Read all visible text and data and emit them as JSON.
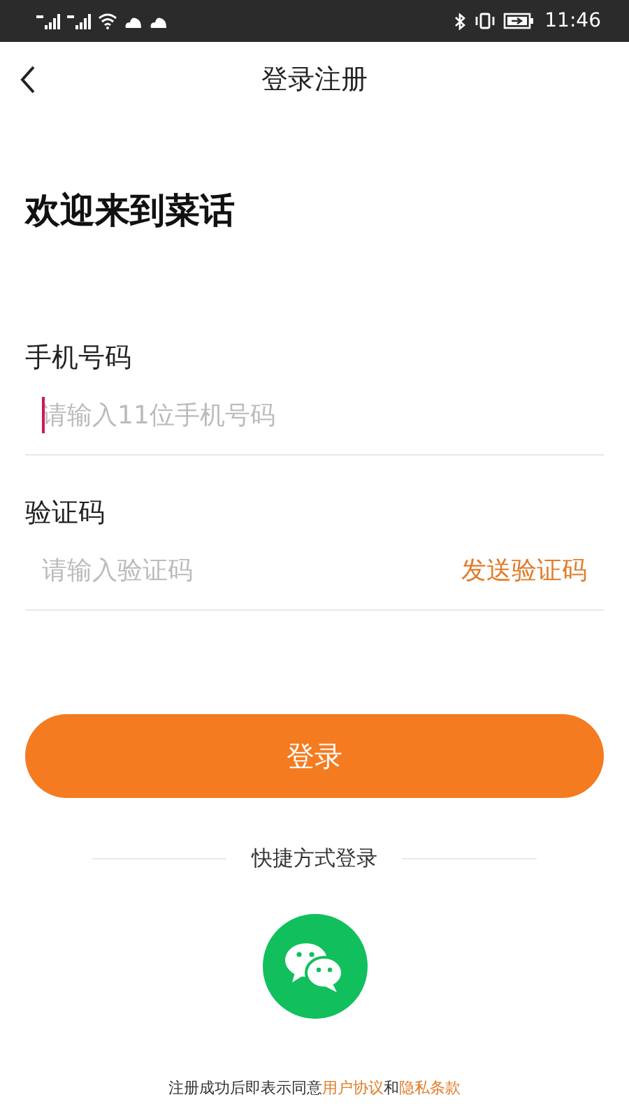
{
  "status_bar": {
    "time": "11:46"
  },
  "nav": {
    "title": "登录注册"
  },
  "heading": "欢迎来到菜话",
  "fields": [
    {
      "label": "手机号码",
      "placeholder": "请输入11位手机号码",
      "focused": true
    },
    {
      "label": "验证码",
      "placeholder": "请输入验证码",
      "focused": false,
      "action": "发送验证码"
    }
  ],
  "login_button": "登录",
  "quick_login": {
    "title": "快捷方式登录"
  },
  "footer": [
    {
      "kind": "text",
      "text": "注册成功后即表示同意"
    },
    {
      "kind": "link",
      "text": "用户协议"
    },
    {
      "kind": "text",
      "text": "和"
    },
    {
      "kind": "link",
      "text": "隐私条款"
    }
  ]
}
